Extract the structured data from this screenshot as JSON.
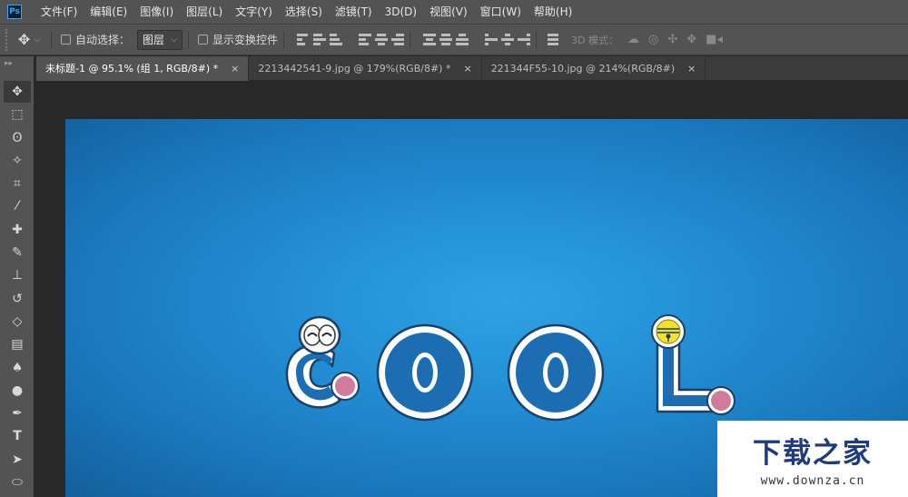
{
  "app": {
    "logo": "Ps"
  },
  "menu": [
    "文件(F)",
    "编辑(E)",
    "图像(I)",
    "图层(L)",
    "文字(Y)",
    "选择(S)",
    "滤镜(T)",
    "3D(D)",
    "视图(V)",
    "窗口(W)",
    "帮助(H)"
  ],
  "options": {
    "auto_select_label": "自动选择：",
    "auto_select_value": "图层",
    "show_transform_label": "显示变换控件",
    "mode_label": "3D 模式："
  },
  "tabs": [
    {
      "title": "未标题-1 @ 95.1% (组 1, RGB/8#) *",
      "active": true
    },
    {
      "title": "2213442541-9.jpg @ 179%(RGB/8#) *",
      "active": false
    },
    {
      "title": "221344F55-10.jpg @ 214%(RGB/8#)",
      "active": false
    }
  ],
  "tab_close_glyph": "×",
  "tools": [
    "move-icon",
    "marquee-icon",
    "lasso-icon",
    "magic-wand-icon",
    "crop-icon",
    "eyedropper-icon",
    "healing-brush-icon",
    "brush-icon",
    "clone-stamp-icon",
    "history-brush-icon",
    "eraser-icon",
    "gradient-icon",
    "blur-icon",
    "dodge-icon",
    "pen-icon",
    "type-icon",
    "path-selection-icon",
    "shape-icon"
  ],
  "canvas": {
    "text": "COOL",
    "colors": {
      "background": "#2a9be0",
      "letter": "#1d6db3",
      "outline": "#ffffff",
      "cheek": "#d07b9b",
      "bell": "#f4e12c"
    }
  },
  "watermark": {
    "title": "下载之家",
    "url": "www.downza.cn"
  }
}
